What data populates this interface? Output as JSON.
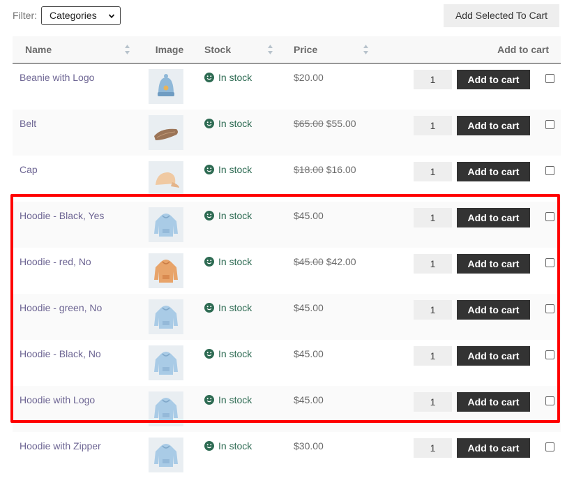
{
  "filter": {
    "label": "Filter:",
    "selected": "Categories"
  },
  "toolbar": {
    "add_selected_label": "Add Selected To Cart"
  },
  "columns": {
    "name": "Name",
    "image": "Image",
    "stock": "Stock",
    "price": "Price",
    "cart": "Add to cart"
  },
  "colors": {
    "highlight": "#ff0000",
    "button": "#333333",
    "link": "#6d6593",
    "stock": "#2e6b53"
  },
  "products": [
    {
      "name": "Beanie with Logo",
      "image_icon": "beanie-icon",
      "stock": "In stock",
      "price_old": "",
      "price": "$20.00",
      "qty": "1",
      "button": "Add to cart"
    },
    {
      "name": "Belt",
      "image_icon": "belt-icon",
      "stock": "In stock",
      "price_old": "$65.00",
      "price": "$55.00",
      "qty": "1",
      "button": "Add to cart"
    },
    {
      "name": "Cap",
      "image_icon": "cap-icon",
      "stock": "In stock",
      "price_old": "$18.00",
      "price": "$16.00",
      "qty": "1",
      "button": "Add to cart"
    },
    {
      "name": "Hoodie - Black, Yes",
      "image_icon": "hoodie-icon",
      "stock": "In stock",
      "price_old": "",
      "price": "$45.00",
      "qty": "1",
      "button": "Add to cart"
    },
    {
      "name": "Hoodie - red, No",
      "image_icon": "hoodie-icon",
      "stock": "In stock",
      "price_old": "$45.00",
      "price": "$42.00",
      "qty": "1",
      "button": "Add to cart"
    },
    {
      "name": "Hoodie - green, No",
      "image_icon": "hoodie-icon",
      "stock": "In stock",
      "price_old": "",
      "price": "$45.00",
      "qty": "1",
      "button": "Add to cart"
    },
    {
      "name": "Hoodie - Black, No",
      "image_icon": "hoodie-icon",
      "stock": "In stock",
      "price_old": "",
      "price": "$45.00",
      "qty": "1",
      "button": "Add to cart"
    },
    {
      "name": "Hoodie with Logo",
      "image_icon": "hoodie-icon",
      "stock": "In stock",
      "price_old": "",
      "price": "$45.00",
      "qty": "1",
      "button": "Add to cart"
    },
    {
      "name": "Hoodie with Zipper",
      "image_icon": "hoodie-icon",
      "stock": "In stock",
      "price_old": "",
      "price": "$30.00",
      "qty": "1",
      "button": "Add to cart"
    }
  ]
}
